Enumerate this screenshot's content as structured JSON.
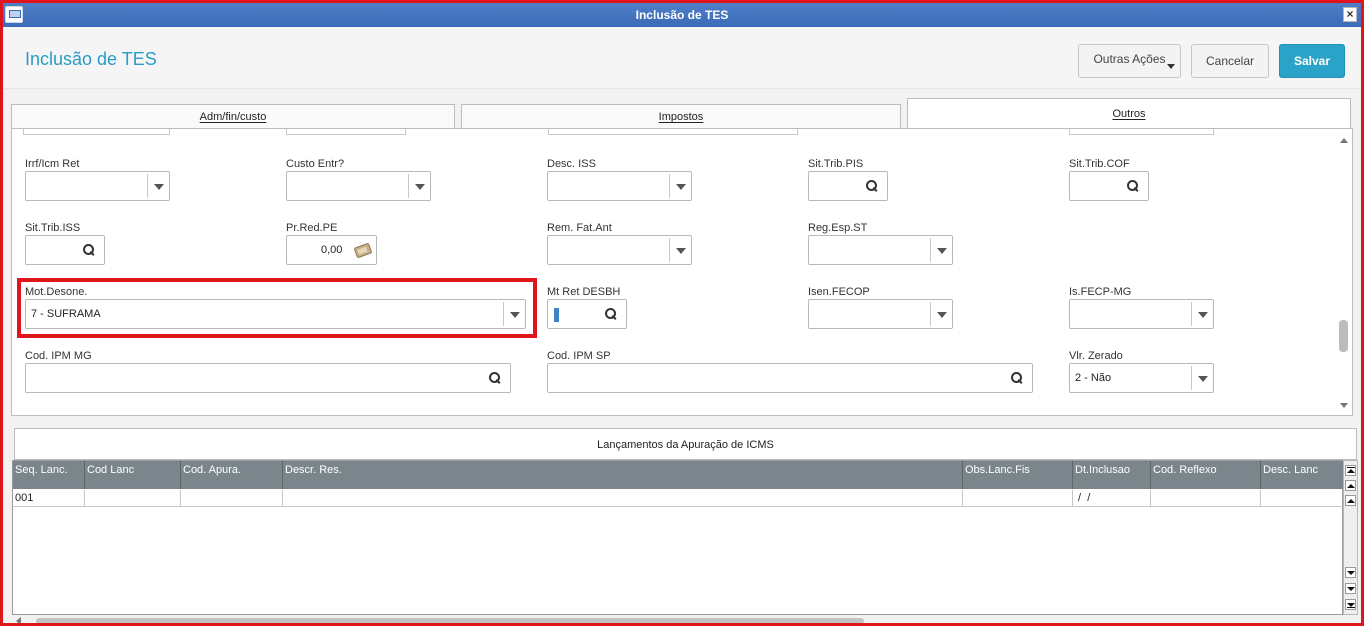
{
  "window": {
    "title": "Inclusão de TES",
    "close_label": "×"
  },
  "header": {
    "page_title": "Inclusão de TES",
    "actions": {
      "outras_acoes": "Outras Ações",
      "cancelar": "Cancelar",
      "salvar": "Salvar"
    }
  },
  "tabs": [
    {
      "label": "Adm/fin/custo"
    },
    {
      "label": "Impostos"
    },
    {
      "label": "Outros",
      "active": true
    }
  ],
  "form": {
    "irrf_icm_ret": {
      "label": "Irrf/Icm Ret",
      "value": ""
    },
    "custo_entr": {
      "label": "Custo Entr?",
      "value": ""
    },
    "desc_iss": {
      "label": "Desc. ISS",
      "value": ""
    },
    "sit_trib_pis": {
      "label": "Sit.Trib.PIS",
      "value": ""
    },
    "sit_trib_cof": {
      "label": "Sit.Trib.COF",
      "value": ""
    },
    "sit_trib_iss": {
      "label": "Sit.Trib.ISS",
      "value": ""
    },
    "pr_red_pe": {
      "label": "Pr.Red.PE",
      "value": "0,00"
    },
    "rem_fat_ant": {
      "label": "Rem. Fat.Ant",
      "value": ""
    },
    "reg_esp_st": {
      "label": "Reg.Esp.ST",
      "value": ""
    },
    "mot_desone": {
      "label": "Mot.Desone.",
      "value": "7 - SUFRAMA"
    },
    "mt_ret_desbh": {
      "label": "Mt Ret DESBH",
      "value": ""
    },
    "isen_fecop": {
      "label": "Isen.FECOP",
      "value": ""
    },
    "is_fecp_mg": {
      "label": "Is.FECP-MG",
      "value": ""
    },
    "cod_ipm_mg": {
      "label": "Cod. IPM MG",
      "value": ""
    },
    "cod_ipm_sp": {
      "label": "Cod. IPM SP",
      "value": ""
    },
    "vlr_zerado": {
      "label": "Vlr. Zerado",
      "value": "2 - Não"
    }
  },
  "grid": {
    "title": "Lançamentos da Apuração de ICMS",
    "columns": [
      "Seq. Lanc.",
      "Cod Lanc",
      "Cod. Apura.",
      "Descr. Res.",
      "Obs.Lanc.Fis",
      "Dt.Inclusao",
      "Cod. Reflexo",
      "Desc. Lanc"
    ],
    "rows": [
      [
        "001",
        "",
        "",
        "",
        "",
        " /  /",
        "",
        ""
      ]
    ]
  },
  "colors": {
    "accent": "#2ba3c8",
    "title_bar": "#3b6ab8",
    "highlight": "#e0141d",
    "grid_header": "#7b868c"
  }
}
